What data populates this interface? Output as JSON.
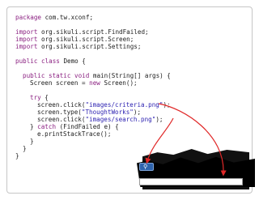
{
  "code": {
    "package_kw": "package",
    "package_rest": " com.tw.xconf;",
    "imports": [
      {
        "kw": "import",
        "rest": " org.sikuli.script.FindFailed;"
      },
      {
        "kw": "import",
        "rest": " org.sikuli.script.Screen;"
      },
      {
        "kw": "import",
        "rest": " org.sikuli.script.Settings;"
      }
    ],
    "class_kw": "public class",
    "class_rest": " Demo {",
    "method_kw": "public static void",
    "method_rest": " main(String[] args) {",
    "screen_decl_a": "Screen screen = ",
    "new_kw": "new",
    "screen_decl_b": " Screen();",
    "try_kw": "try",
    "try_rest": " {",
    "calls": [
      {
        "pre": "screen.click(",
        "str": "\"images/criteria.png\"",
        "post": ");"
      },
      {
        "pre": "screen.type(",
        "str": "\"ThoughtWorks\"",
        "post": ");"
      },
      {
        "pre": "screen.click(",
        "str": "\"images/search.png\"",
        "post": ");"
      }
    ],
    "catch_a": "} ",
    "catch_kw": "catch",
    "catch_b": " (FindFailed e) {",
    "stack_trace": "e.printStackTrace();",
    "close_inner": "}",
    "close_method": "}",
    "close_class": "}"
  },
  "snippet": {
    "search_icon": "search-icon"
  },
  "colors": {
    "keyword": "#8a1f80",
    "string": "#2a1fb0",
    "arrow": "#e02828"
  }
}
